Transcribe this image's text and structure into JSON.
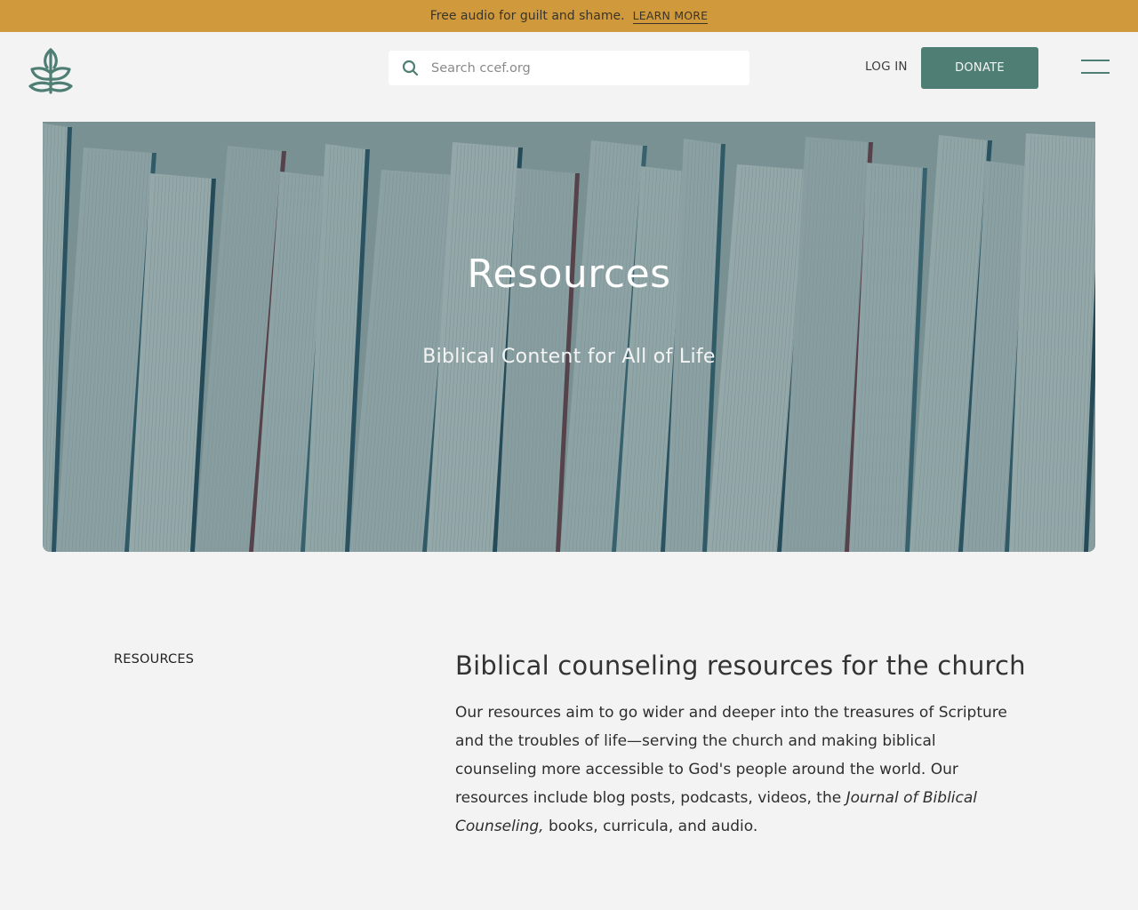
{
  "banner": {
    "text": "Free audio for guilt and shame.",
    "link_label": "LEARN MORE"
  },
  "header": {
    "logo_icon": "ccef-leaf-logo",
    "search": {
      "placeholder": "Search ccef.org",
      "value": ""
    },
    "login_label": "LOG IN",
    "donate_label": "DONATE",
    "menu_icon": "hamburger-menu-icon"
  },
  "hero": {
    "title": "Resources",
    "subtitle": "Biblical Content for All of Life"
  },
  "section": {
    "side_label": "RESOURCES",
    "title": "Biblical counseling resources for the church",
    "body_before": "Our resources aim to go wider and deeper into the treasures of Scripture and the troubles of life—serving the church and making biblical counseling more accessible to God's people around the world. Our resources include blog posts, podcasts, videos, the ",
    "body_italic": "Journal of Biblical Counseling,",
    "body_after": " books, curricula, and audio."
  },
  "colors": {
    "banner": "#d09a3c",
    "brand_green": "#4f7f74",
    "page_bg": "#f3f3f3"
  }
}
